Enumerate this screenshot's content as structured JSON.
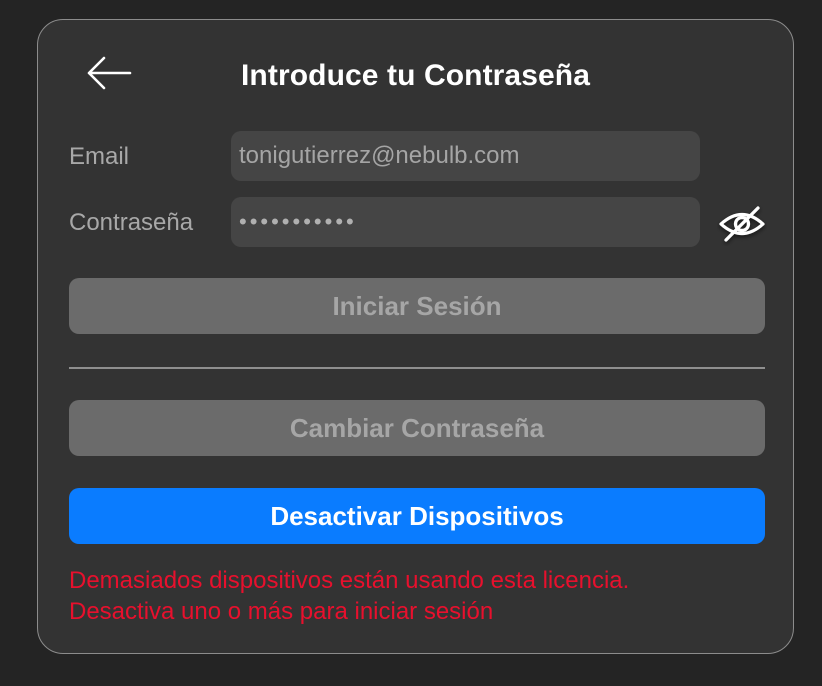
{
  "dialog": {
    "title": "Introduce tu Contraseña",
    "back_icon": "arrow-left-icon"
  },
  "form": {
    "email": {
      "label": "Email",
      "value": "tonigutierrez@nebulb.com"
    },
    "password": {
      "label": "Contraseña",
      "value": "•••••••••••",
      "toggle_icon": "eye-slash-icon"
    }
  },
  "buttons": {
    "login_label": "Iniciar Sesión",
    "change_password_label": "Cambiar Contraseña",
    "deactivate_devices_label": "Desactivar Dispositivos"
  },
  "error": {
    "line1": "Demasiados dispositivos están usando esta licencia.",
    "line2": "Desactiva uno o más para iniciar sesión"
  },
  "colors": {
    "page_background": "#242424",
    "dialog_background": "#333333",
    "input_background": "#454545",
    "disabled_button": "#6b6b6b",
    "primary_button": "#0a7cff",
    "error_text": "#e8102d"
  }
}
